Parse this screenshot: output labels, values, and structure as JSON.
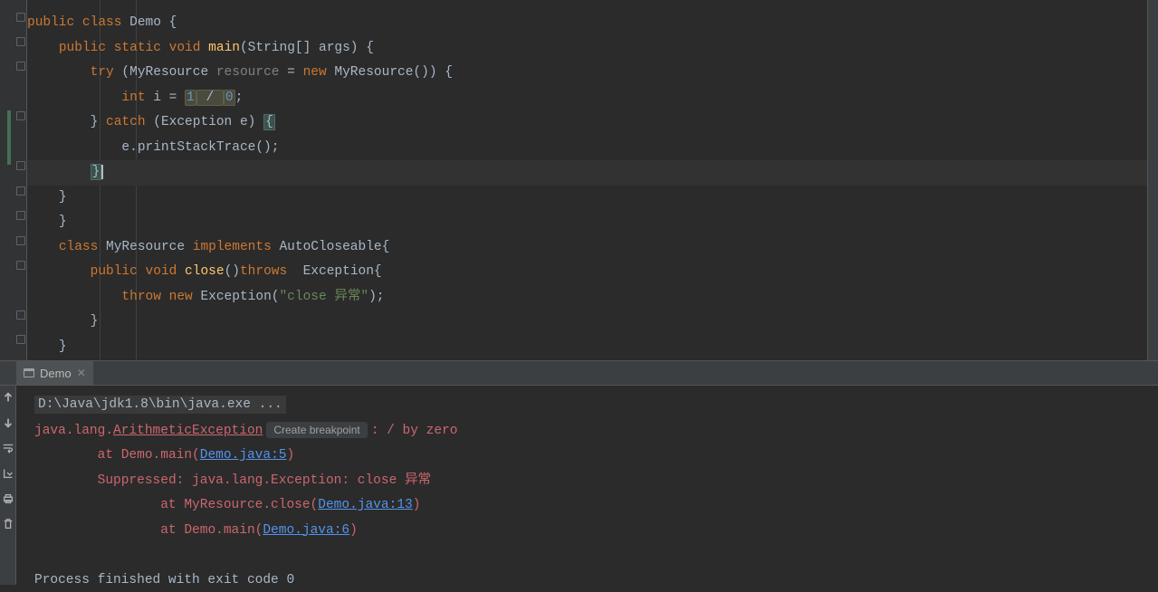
{
  "tab": {
    "name": "Demo"
  },
  "code": {
    "l1": {
      "kw1": "public",
      "kw2": "class",
      "name": "Demo",
      "brace": " {"
    },
    "l2": {
      "kw1": "public",
      "kw2": "static",
      "kw3": "void",
      "meth": "main",
      "sig": "(String[] args) {"
    },
    "l3": {
      "kw1": "try",
      "paren": " (MyResource ",
      "param": "resource",
      "eq": " = ",
      "kw2": "new",
      "ctor": " MyResource()) {"
    },
    "l4": {
      "kw1": "int",
      "var": " i ",
      "eq": "= ",
      "n1": "1",
      "op": " / ",
      "n2": "0",
      "semi": ";"
    },
    "l5": {
      "close": "} ",
      "kw1": "catch",
      "sig": " (Exception e) ",
      "brace": "{"
    },
    "l6": {
      "expr": "e.printStackTrace();"
    },
    "l7": {
      "brace": "}"
    },
    "l8": {
      "brace": "}"
    },
    "l9": {
      "brace": "}"
    },
    "l10": {
      "kw1": "class",
      "name": " MyResource ",
      "kw2": "implements",
      "iface": " AutoCloseable{"
    },
    "l11": {
      "kw1": "public",
      "kw2": " void",
      "meth": " close",
      "par": "()",
      "kw3": "throws",
      "rest": "  Exception{"
    },
    "l12": {
      "kw1": "throw",
      "kw2": " new",
      "cls": " Exception(",
      "str": "\"close 异常\"",
      "end": ");"
    },
    "l13": {
      "brace": "}"
    },
    "l14": {
      "brace": "}"
    }
  },
  "console": {
    "cmd": "D:\\Java\\jdk1.8\\bin\\java.exe ...",
    "l2_pkg": "java.lang.",
    "l2_exc": "ArithmeticException",
    "l2_btn": "Create breakpoint",
    "l2_msg": ": / by zero",
    "l3_at": "\tat Demo.main(",
    "l3_link": "Demo.java:5",
    "l3_end": ")",
    "l4": "\tSuppressed: java.lang.Exception: close 异常",
    "l5_at": "\t\tat MyResource.close(",
    "l5_link": "Demo.java:13",
    "l5_end": ")",
    "l6_at": "\t\tat Demo.main(",
    "l6_link": "Demo.java:6",
    "l6_end": ")",
    "exit": "Process finished with exit code 0"
  }
}
